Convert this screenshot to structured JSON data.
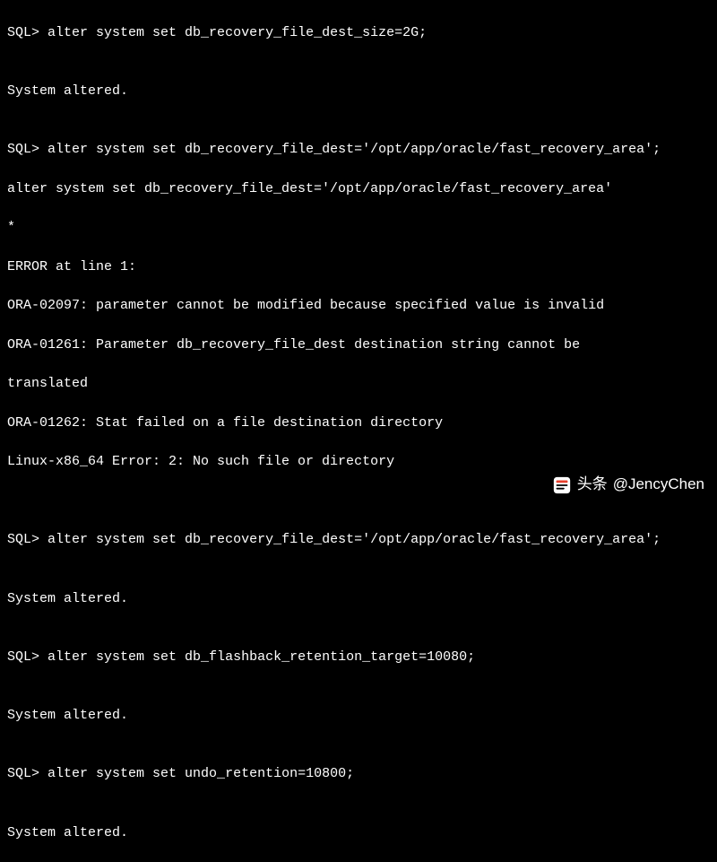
{
  "prompt": "SQL>",
  "lines": {
    "l1_cmd": "alter system set db_recovery_file_dest_size=2G;",
    "l2_blank": "",
    "l3_resp": "System altered.",
    "l4_blank": "",
    "l5_cmd": "alter system set db_recovery_file_dest='/opt/app/oracle/fast_recovery_area';",
    "l6_echo": "alter system set db_recovery_file_dest='/opt/app/oracle/fast_recovery_area'",
    "l7_star": "*",
    "l8_err": "ERROR at line 1:",
    "l9_err": "ORA-02097: parameter cannot be modified because specified value is invalid",
    "l10_err": "ORA-01261: Parameter db_recovery_file_dest destination string cannot be",
    "l11_err": "translated",
    "l12_err": "ORA-01262: Stat failed on a file destination directory",
    "l13_err": "Linux-x86_64 Error: 2: No such file or directory",
    "l14_blank": "",
    "l15_blank": "",
    "l16_cmd": "alter system set db_recovery_file_dest='/opt/app/oracle/fast_recovery_area';",
    "l17_blank": "",
    "l18_resp": "System altered.",
    "l19_blank": "",
    "l20_cmd": "alter system set db_flashback_retention_target=10080;",
    "l21_blank": "",
    "l22_resp": "System altered.",
    "l23_blank": "",
    "l24_cmd": "alter system set undo_retention=10800;",
    "l25_blank": "",
    "l26_resp": "System altered."
  },
  "watermark": {
    "label_prefix": "头条",
    "label_handle": "@JencyChen"
  }
}
